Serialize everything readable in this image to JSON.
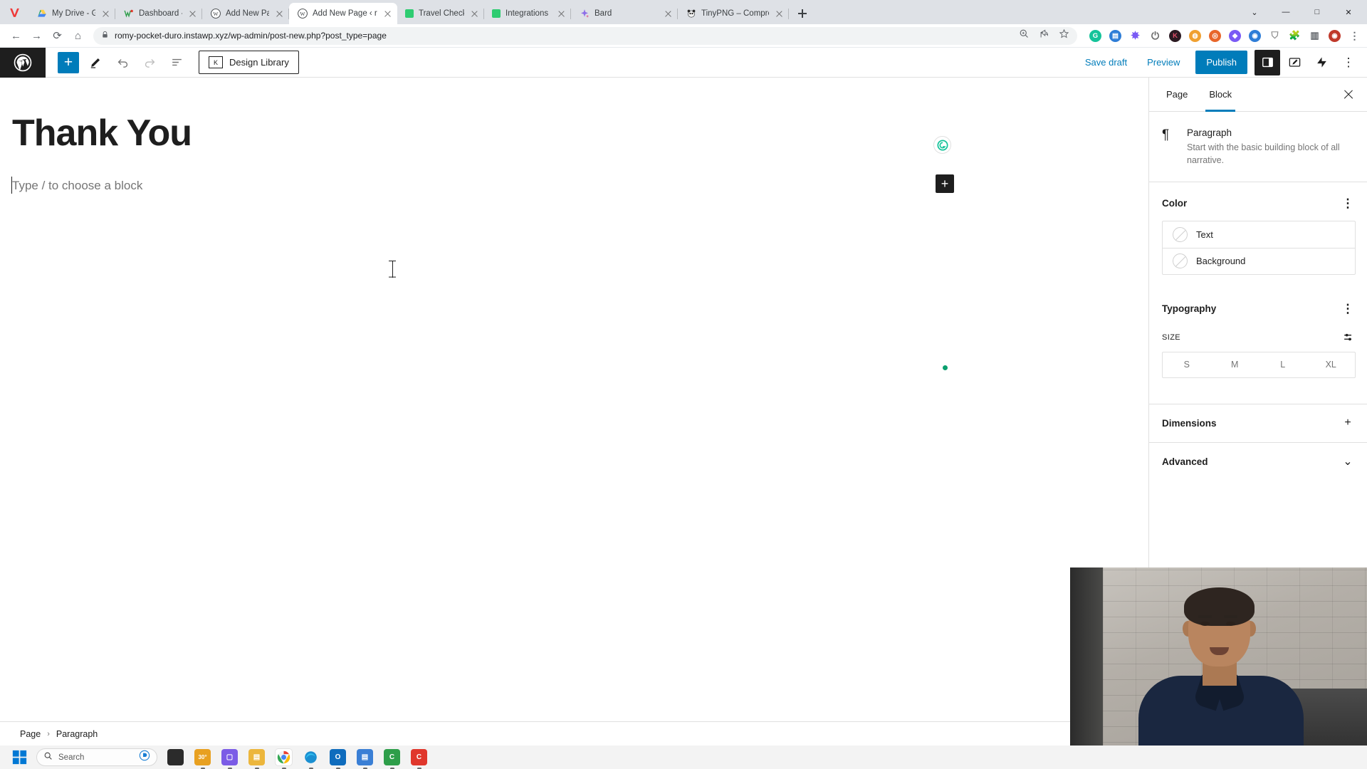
{
  "browser": {
    "tabs": [
      {
        "title": "My Drive - Google Drive",
        "favicon": "google-drive-icon",
        "active": false
      },
      {
        "title": "Dashboard - InstaWP",
        "favicon": "instawp-icon",
        "active": false
      },
      {
        "title": "Add New Page ‹ romy-po",
        "favicon": "wordpress-icon",
        "active": false
      },
      {
        "title": "Add New Page ‹ romy-po",
        "favicon": "wordpress-icon",
        "active": true
      },
      {
        "title": "Travel Checklist | Rich text",
        "favicon": "green-square-icon",
        "active": false
      },
      {
        "title": "Integrations | MailerLite",
        "favicon": "green-square-icon",
        "active": false
      },
      {
        "title": "Bard",
        "favicon": "bard-sparkle-icon",
        "active": false
      },
      {
        "title": "TinyPNG – Compress Web",
        "favicon": "tinypng-panda-icon",
        "active": false
      }
    ],
    "new_tab_label": "+",
    "window_controls": {
      "minimize": "—",
      "maximize": "□",
      "close": "✕",
      "restore": "⌄"
    },
    "url": "romy-pocket-duro.instawp.xyz/wp-admin/post-new.php?post_type=page",
    "nav": {
      "back": "←",
      "forward": "→",
      "reload": "⟳",
      "home": "⌂"
    },
    "omnibox_icons": [
      "lock-icon",
      "zoom-icon",
      "share-icon",
      "bookmark-star-icon"
    ],
    "extensions": [
      {
        "name": "grammarly-extension-icon",
        "glyph": "G",
        "color": "#15c39a"
      },
      {
        "name": "notes-extension-icon",
        "glyph": "⊟",
        "color": "#2e7dd7"
      },
      {
        "name": "settings-extension-icon",
        "glyph": "✸",
        "color": "#7a5af5"
      },
      {
        "name": "power-extension-icon",
        "glyph": "⏻",
        "color": "#6b6b6b"
      },
      {
        "name": "kagi-extension-icon",
        "glyph": "K",
        "color": "#2b1a22"
      },
      {
        "name": "wordpress-extension-icon",
        "glyph": "W",
        "color": "#3858e9"
      },
      {
        "name": "shield-extension-icon",
        "glyph": "⛉",
        "color": "#8b8b8b"
      },
      {
        "name": "puzzle-extension-icon",
        "glyph": "🧩",
        "color": "#5f6368"
      },
      {
        "name": "sidepanel-icon",
        "glyph": "▥",
        "color": "#5f6368"
      },
      {
        "name": "profile-avatar-icon",
        "glyph": "◉",
        "color": "#c0392b"
      },
      {
        "name": "browser-menu-icon",
        "glyph": "⋮",
        "color": "#5f6368"
      }
    ]
  },
  "editor": {
    "logo": "wordpress-logo-icon",
    "toolbar": {
      "add_block": "+",
      "tools_pen": "pencil-icon",
      "undo": "undo-icon",
      "redo": "redo-icon",
      "list_view": "list-view-icon",
      "design_library": "Design Library",
      "design_library_icon": "design-library-icon"
    },
    "actions": {
      "save_draft": "Save draft",
      "preview": "Preview",
      "publish": "Publish",
      "settings_toggle": "settings-panel-icon",
      "editor_mode": "edit-mode-icon",
      "jetpack": "jetpack-icon",
      "more_options": "⋮"
    },
    "content": {
      "title": "Thank You",
      "paragraph_placeholder": "Type / to choose a block",
      "grammarly_badge": "grammarly-status-icon",
      "block_inserter": "+"
    }
  },
  "sidebar": {
    "tabs": [
      {
        "label": "Page",
        "active": false
      },
      {
        "label": "Block",
        "active": true
      }
    ],
    "close_label": "close-sidebar-icon",
    "block_card": {
      "icon": "paragraph-pilcrow-icon",
      "name": "Paragraph",
      "description": "Start with the basic building block of all narrative."
    },
    "color": {
      "title": "Color",
      "options_icon": "⋮",
      "rows": [
        {
          "label": "Text",
          "swatch": "empty-swatch-icon"
        },
        {
          "label": "Background",
          "swatch": "empty-swatch-icon"
        }
      ]
    },
    "typography": {
      "title": "Typography",
      "options_icon": "⋮",
      "size_label": "SIZE",
      "sliders_icon": "typography-sliders-icon",
      "sizes": [
        "S",
        "M",
        "L",
        "XL"
      ],
      "selected_size": null
    },
    "dimensions": {
      "title": "Dimensions",
      "action": "+"
    },
    "advanced": {
      "title": "Advanced",
      "action": "⌄"
    }
  },
  "breadcrumb": {
    "items": [
      "Page",
      "Paragraph"
    ],
    "separator": "›"
  },
  "taskbar": {
    "start": "windows-start-icon",
    "search_placeholder": "Search",
    "search_icon": "search-icon",
    "copilot_icon": "copilot-icon",
    "weather": "30°",
    "apps": [
      {
        "name": "file-explorer-dark-icon",
        "glyph": "▮",
        "color": "#2b2b2b"
      },
      {
        "name": "weather-widget-icon",
        "glyph": "30°",
        "color": "#e8a020"
      },
      {
        "name": "zoom-app-icon",
        "glyph": "▢",
        "color": "#7b5ce6"
      },
      {
        "name": "file-explorer-icon",
        "glyph": "▤",
        "color": "#ecb63c"
      },
      {
        "name": "chrome-icon",
        "glyph": "◉",
        "color": "#4285f4"
      },
      {
        "name": "edge-icon",
        "glyph": "◎",
        "color": "#1a8fd1"
      },
      {
        "name": "outlook-icon",
        "glyph": "O",
        "color": "#0f6cbd"
      },
      {
        "name": "notepad-icon",
        "glyph": "▤",
        "color": "#3a7fd5"
      },
      {
        "name": "camtasia-icon",
        "glyph": "C",
        "color": "#2e9e4a"
      },
      {
        "name": "camtasia-recorder-icon",
        "glyph": "C",
        "color": "#e0372c"
      }
    ]
  },
  "colors": {
    "accent": "#007cba",
    "tabstrip_bg": "#dee1e6",
    "editor_dark": "#1e1e1e",
    "grammarly_green": "#15c39a",
    "status_green": "#0a9f6e"
  }
}
